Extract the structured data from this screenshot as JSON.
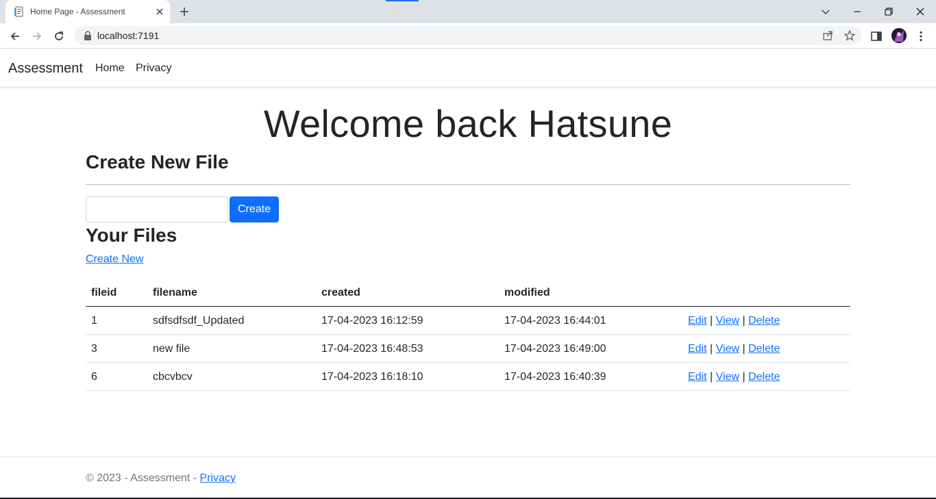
{
  "browser": {
    "tab_title": "Home Page - Assessment",
    "url": "localhost:7191"
  },
  "navbar": {
    "brand": "Assessment",
    "links": [
      "Home",
      "Privacy"
    ]
  },
  "main": {
    "welcome": "Welcome back Hatsune",
    "create_heading": "Create New File",
    "filename_value": "",
    "create_button": "Create",
    "files_heading": "Your Files",
    "create_new_link": "Create New",
    "table": {
      "headers": [
        "fileid",
        "filename",
        "created",
        "modified"
      ],
      "rows": [
        {
          "fileid": "1",
          "filename": "sdfsdfsdf_Updated",
          "created": "17-04-2023 16:12:59",
          "modified": "17-04-2023 16:44:01"
        },
        {
          "fileid": "3",
          "filename": "new file",
          "created": "17-04-2023 16:48:53",
          "modified": "17-04-2023 16:49:00"
        },
        {
          "fileid": "6",
          "filename": "cbcvbcv",
          "created": "17-04-2023 16:18:10",
          "modified": "17-04-2023 16:40:39"
        }
      ],
      "actions": {
        "edit": "Edit",
        "view": "View",
        "delete": "Delete",
        "separator": "|"
      }
    }
  },
  "footer": {
    "text": "© 2023 - Assessment - ",
    "privacy_link": "Privacy"
  },
  "colors": {
    "primary": "#0d6efd",
    "text": "#212529",
    "muted": "#6c757d"
  }
}
